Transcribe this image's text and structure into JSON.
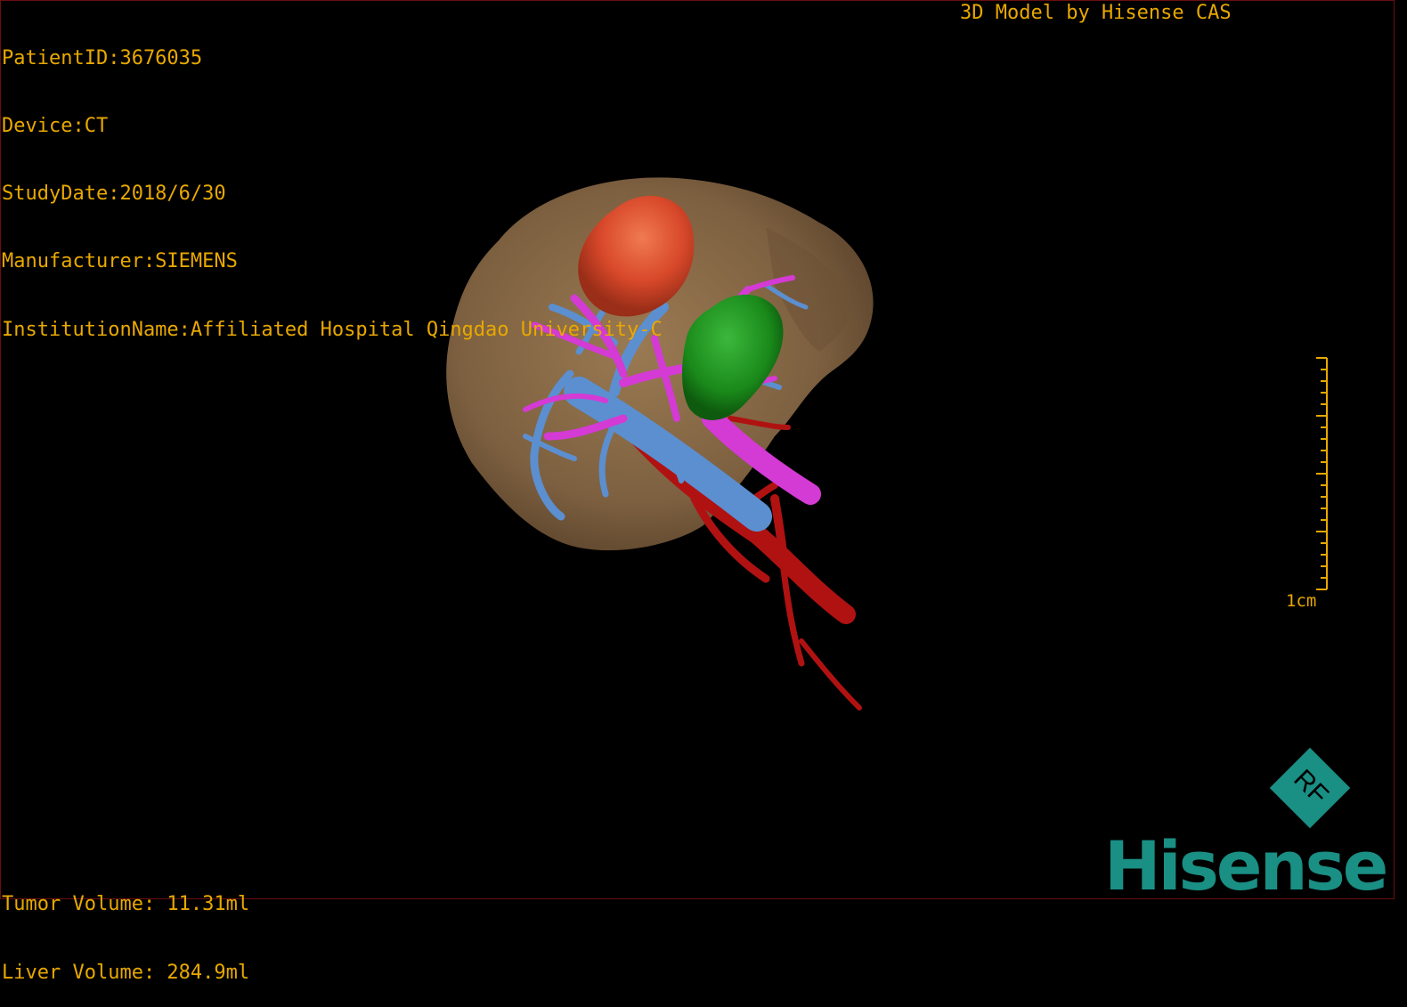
{
  "header": {
    "patient_id": "PatientID:3676035",
    "device": "Device:CT",
    "study_date": "StudyDate:2018/6/30",
    "manufacturer": "Manufacturer:SIEMENS",
    "institution": "InstitutionName:Affiliated Hospital Qingdao University-C"
  },
  "brand_caption": "3D Model by Hisense CAS",
  "volumes": {
    "tumor": "Tumor Volume: 11.31ml",
    "liver": "Liver Volume: 284.9ml"
  },
  "scale_bar": {
    "label": "1cm"
  },
  "logo": {
    "word": "Hisense",
    "badge_letters": "RF"
  },
  "colors": {
    "overlay_text": "#e8a800",
    "liver": "#8a6a45",
    "tumor": "#e0522a",
    "green_structure": "#1f8f1f",
    "portal_vein": "#5b8fd0",
    "hepatic_vein": "#d43ad4",
    "artery": "#b01212",
    "logo": "#1a8f84"
  },
  "icons": [
    "rf-diamond-icon"
  ]
}
